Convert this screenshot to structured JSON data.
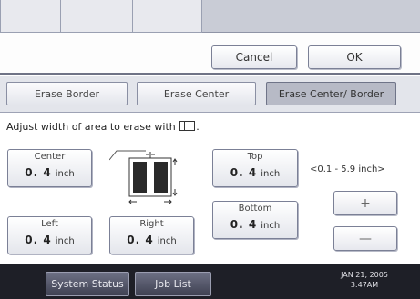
{
  "header": {
    "cancel_label": "Cancel",
    "ok_label": "OK"
  },
  "mode_tabs": [
    {
      "label": "Erase Border",
      "selected": false
    },
    {
      "label": "Erase Center",
      "selected": false
    },
    {
      "label": "Erase Center/ Border",
      "selected": true
    }
  ],
  "instruction": {
    "before": "Adjust width of area to erase with",
    "after": "."
  },
  "fields": {
    "center": {
      "label": "Center",
      "value": "0. 4",
      "unit": "inch"
    },
    "top": {
      "label": "Top",
      "value": "0. 4",
      "unit": "inch"
    },
    "bottom": {
      "label": "Bottom",
      "value": "0. 4",
      "unit": "inch"
    },
    "left": {
      "label": "Left",
      "value": "0. 4",
      "unit": "inch"
    },
    "right": {
      "label": "Right",
      "value": "0. 4",
      "unit": "inch"
    }
  },
  "range_text": "<0.1 - 5.9 inch>",
  "plus_label": "+",
  "minus_label": "—",
  "footer": {
    "system_status": "System Status",
    "job_list": "Job List",
    "date": "JAN 21, 2005",
    "time": "3:47AM"
  },
  "colors": {
    "selected_tab": "#b7bac6",
    "footer_bg": "#1e1f27",
    "header_bg": "#c9ccd6"
  }
}
